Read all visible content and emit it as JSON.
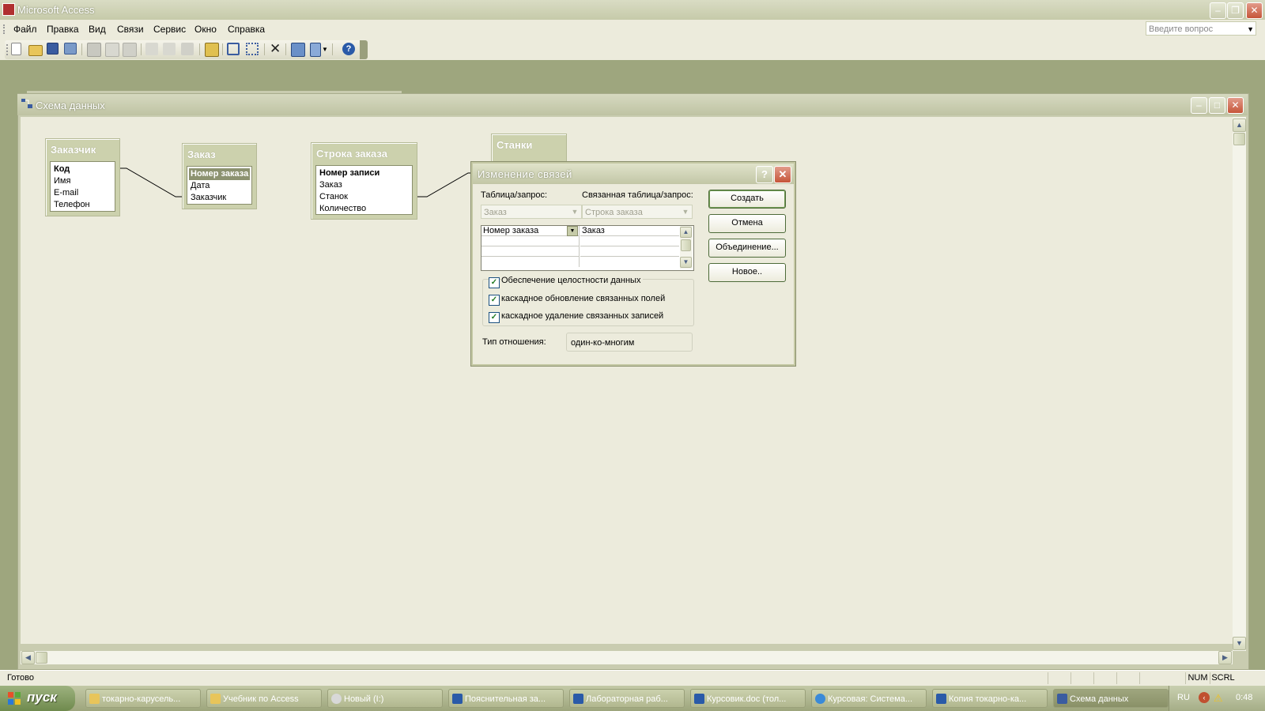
{
  "app": {
    "title": "Microsoft Access"
  },
  "menu": {
    "items": [
      {
        "label": "Файл"
      },
      {
        "label": "Правка"
      },
      {
        "label": "Вид"
      },
      {
        "label": "Связи"
      },
      {
        "label": "Сервис"
      },
      {
        "label": "Окно"
      },
      {
        "label": "Справка"
      }
    ],
    "ask_placeholder": "Введите вопрос"
  },
  "toolbar": {
    "icons": [
      "new-icon",
      "open-icon",
      "save-icon",
      "print-preview-icon",
      "print-icon",
      "preview-icon",
      "spelling-icon",
      "cut-icon",
      "copy-icon",
      "paste-icon",
      "show-table-icon",
      "direct-relationships-icon",
      "all-relationships-icon",
      "delete-icon",
      "new-object-icon",
      "office-links-icon",
      "help-icon"
    ]
  },
  "schema_window": {
    "title": "Схема данных"
  },
  "tables": [
    {
      "title": "Заказчик",
      "fields": [
        {
          "name": "Код",
          "bold": true
        },
        {
          "name": "Имя"
        },
        {
          "name": "E-mail"
        },
        {
          "name": "Телефон"
        }
      ]
    },
    {
      "title": "Заказ",
      "fields": [
        {
          "name": "Номер заказа",
          "bold": true,
          "selected": true
        },
        {
          "name": "Дата"
        },
        {
          "name": "Заказчик"
        }
      ]
    },
    {
      "title": "Строка заказа",
      "fields": [
        {
          "name": "Номер записи",
          "bold": true
        },
        {
          "name": "Заказ"
        },
        {
          "name": "Станок"
        },
        {
          "name": "Количество"
        }
      ]
    },
    {
      "title": "Станки",
      "fields": []
    }
  ],
  "dialog": {
    "title": "Изменение связей",
    "table_label": "Таблица/запрос:",
    "related_label": "Связанная таблица/запрос:",
    "table_value": "Заказ",
    "related_value": "Строка заказа",
    "grid_rows": [
      {
        "left": "Номер заказа",
        "right": "Заказ"
      },
      {
        "left": "",
        "right": ""
      },
      {
        "left": "",
        "right": ""
      },
      {
        "left": "",
        "right": ""
      }
    ],
    "checkboxes": [
      {
        "label": "Обеспечение целостности данных",
        "checked": true
      },
      {
        "label": "каскадное обновление связанных полей",
        "checked": true
      },
      {
        "label": "каскадное удаление связанных записей",
        "checked": true
      }
    ],
    "reltype_label": "Тип отношения:",
    "reltype_value": "один-ко-многим",
    "buttons": {
      "create": "Создать",
      "cancel": "Отмена",
      "join": "Объединение...",
      "new": "Новое.."
    }
  },
  "status": {
    "text": "Готово",
    "num": "NUM",
    "scrl": "SCRL"
  },
  "taskbar": {
    "start": "пуск",
    "buttons": [
      {
        "label": "токарно-карусель...",
        "icon": "folder-icon"
      },
      {
        "label": "Учебник по Access",
        "icon": "folder-icon"
      },
      {
        "label": "Новый (I:)",
        "icon": "drive-icon"
      },
      {
        "label": "Пояснительная за...",
        "icon": "word-icon"
      },
      {
        "label": "Лабораторная раб...",
        "icon": "word-icon"
      },
      {
        "label": "Курсовик.doc (тол...",
        "icon": "word-icon"
      },
      {
        "label": "Курсовая: Система...",
        "icon": "ie-icon"
      },
      {
        "label": "Копия токарно-ка...",
        "icon": "word-icon"
      },
      {
        "label": "Схема данных",
        "icon": "schema-icon"
      }
    ],
    "lang": "RU",
    "clock": "0:48"
  }
}
